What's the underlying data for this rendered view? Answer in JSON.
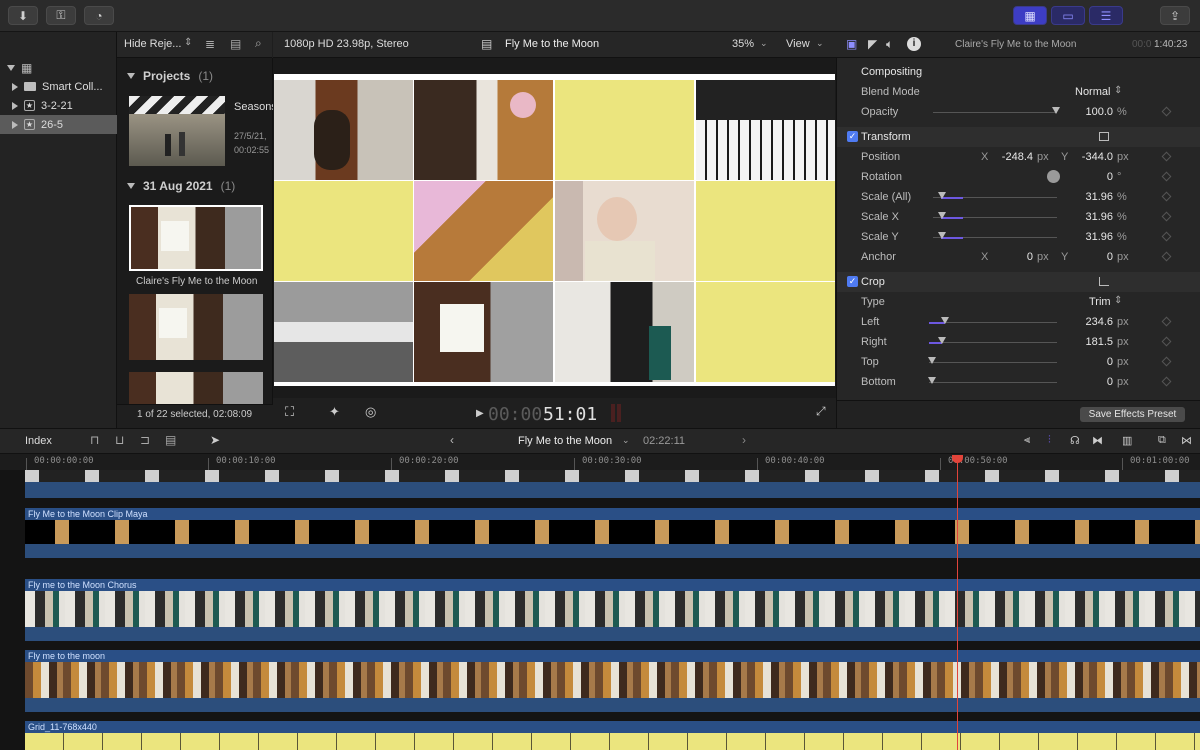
{
  "toolbar": {
    "buttons": [
      "import-icon",
      "keyword-icon",
      "background-tasks-icon",
      "library-view-icon",
      "timeline-view-icon",
      "inspector-view-icon",
      "share-icon"
    ]
  },
  "library": {
    "header_filter": "Hide Reje...",
    "items": [
      {
        "label": "Smart Coll...",
        "kind": "folder"
      },
      {
        "label": "3-2-21",
        "kind": "event"
      },
      {
        "label": "26-5",
        "kind": "event"
      }
    ]
  },
  "browser": {
    "projects_label": "Projects",
    "projects_count": "(1)",
    "project_name": "Seasons",
    "project_date": "27/5/21,",
    "project_duration": "00:02:55",
    "event_label": "31 Aug 2021",
    "event_count": "(1)",
    "clip_name": "Claire's Fly Me to the Moon",
    "footer": "1 of 22 selected, 02:08:09"
  },
  "viewer": {
    "format": "1080p HD 23.98p, Stereo",
    "title": "Fly Me to the Moon",
    "zoom": "35%",
    "view_label": "View",
    "timecode_dim": "00:00",
    "timecode_bright": "51:01"
  },
  "inspector": {
    "title": "Claire's Fly Me to the Moon",
    "time_dim": "00:0",
    "time": "1:40:23",
    "compositing": "Compositing",
    "blend_mode_label": "Blend Mode",
    "blend_mode": "Normal",
    "opacity_label": "Opacity",
    "opacity": "100.0",
    "opacity_unit": "%",
    "transform": "Transform",
    "position_label": "Position",
    "pos_x_label": "X",
    "pos_x": "-248.4",
    "pos_y_label": "Y",
    "pos_y": "-344.0",
    "px": "px",
    "rotation_label": "Rotation",
    "rotation": "0",
    "deg": "°",
    "scale_all_label": "Scale (All)",
    "scale_all": "31.96",
    "scale_x_label": "Scale X",
    "scale_x": "31.96",
    "scale_y_label": "Scale Y",
    "scale_y": "31.96",
    "anchor_label": "Anchor",
    "anchor_x": "0",
    "anchor_y": "0",
    "crop": "Crop",
    "type_label": "Type",
    "type": "Trim",
    "left_label": "Left",
    "left": "234.6",
    "right_label": "Right",
    "right": "181.5",
    "top_label": "Top",
    "top": "0",
    "bottom_label": "Bottom",
    "bottom": "0",
    "save_preset": "Save Effects Preset"
  },
  "timeline": {
    "index_label": "Index",
    "project": "Fly Me to the Moon",
    "duration": "02:22:11",
    "ruler": [
      "00:00:00:00",
      "00:00:10:00",
      "00:00:20:00",
      "00:00:30:00",
      "00:00:40:00",
      "00:00:50:00",
      "00:01:00:00"
    ],
    "clips": [
      "Fly Me to the Moon Clip Maya",
      "Fly me to the Moon Chorus",
      "Fly me to the moon",
      "Grid_11-768x440"
    ]
  },
  "colors": {
    "accent": "#6d58e0",
    "check": "#4f7bf2",
    "clip_blue": "#2a4f86",
    "grid_yellow": "#ebe57e",
    "playhead": "#e2443a"
  }
}
